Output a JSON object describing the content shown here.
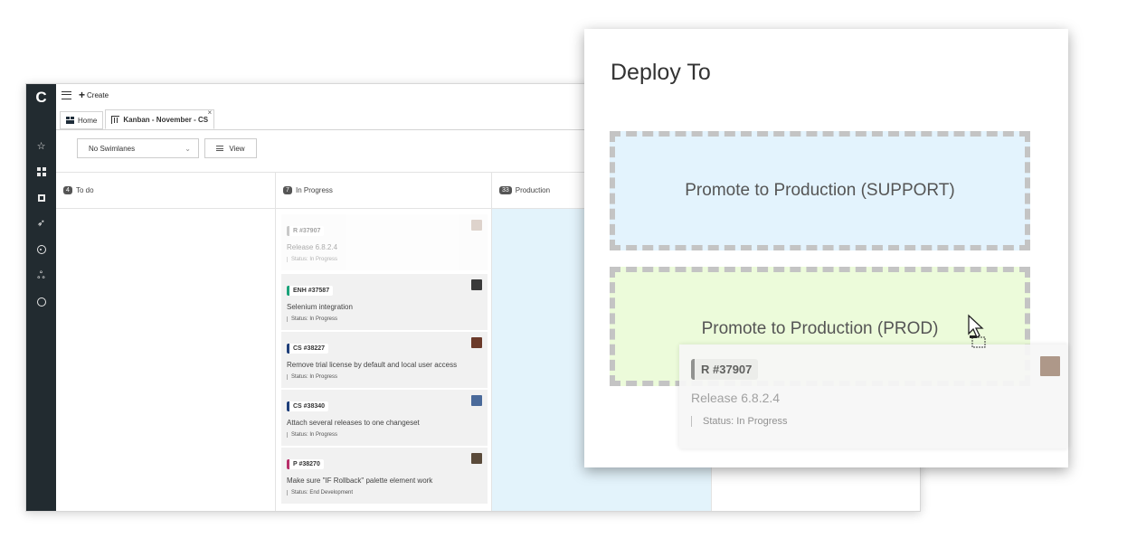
{
  "app": {
    "logo": "C",
    "create_label": "Create",
    "tabs": [
      {
        "label": "Home"
      },
      {
        "label": "Kanban - November - CS",
        "close": "×"
      }
    ],
    "toolbar": {
      "swimlanes_value": "No Swimlanes",
      "view_label": "View"
    }
  },
  "board": {
    "columns": [
      {
        "count": "4",
        "name": "To do"
      },
      {
        "count": "7",
        "name": "In Progress"
      },
      {
        "count": "33",
        "name": "Production"
      }
    ],
    "cards": [
      {
        "tag": "R #37907",
        "title": "Release 6.8.2.4",
        "status": "Status: In Progress",
        "tag_color": "#999999"
      },
      {
        "tag": "ENH #37587",
        "title": "Selenium integration",
        "status": "Status: In Progress",
        "tag_color": "#1aa37a"
      },
      {
        "tag": "CS #38227",
        "title": "Remove trial license by default and local user access",
        "status": "Status: In Progress",
        "tag_color": "#1f3f7a"
      },
      {
        "tag": "CS #38340",
        "title": "Attach several releases to one changeset",
        "status": "Status: In Progress",
        "tag_color": "#1f3f7a"
      },
      {
        "tag": "P #38270",
        "title": "Make sure \"IF Rollback\" palette element work",
        "status": "Status: End Development",
        "tag_color": "#b8306a"
      }
    ]
  },
  "dialog": {
    "title": "Deploy To",
    "targets": [
      {
        "label": "Promote to Production (SUPPORT)"
      },
      {
        "label": "Promote to Production (PROD)"
      }
    ]
  },
  "drag_card": {
    "tag": "R #37907",
    "title": "Release 6.8.2.4",
    "status": "Status: In Progress"
  },
  "icons": [
    "menu-icon",
    "plus-icon",
    "star-icon",
    "dashboard-icon",
    "square-icon",
    "rocket-icon",
    "target-icon",
    "hierarchy-icon",
    "help-icon",
    "home-icon",
    "kanban-icon",
    "list-icon",
    "chevron-down-icon",
    "cursor-icon"
  ]
}
